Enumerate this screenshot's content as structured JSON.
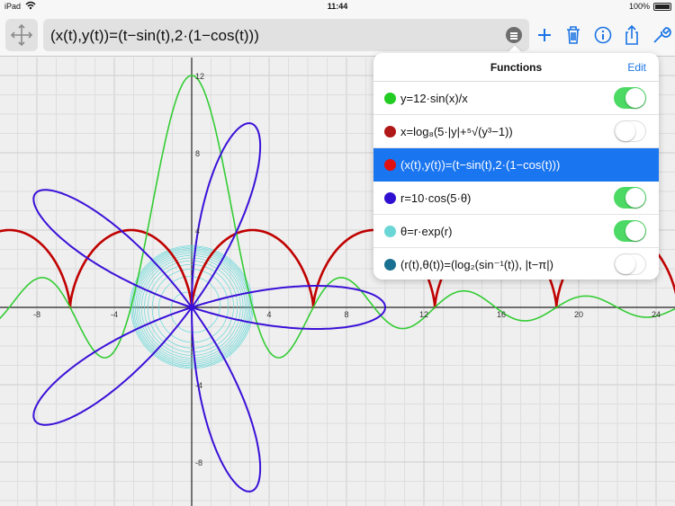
{
  "status": {
    "device": "iPad",
    "time": "11:44",
    "battery": "100%"
  },
  "toolbar": {
    "expression": "(x(t),y(t))=(t−sin(t),2·(1−cos(t)))"
  },
  "functions_panel": {
    "title": "Functions",
    "edit_label": "Edit",
    "items": [
      {
        "text": "y=12·sin(x)/x",
        "color": "#22cc22",
        "enabled": true
      },
      {
        "text": "x=log₈(5·|y|+⁵√(y³−1))",
        "color": "#b01818",
        "enabled": false
      },
      {
        "text": "(x(t),y(t))=(t−sin(t),2·(1−cos(t)))",
        "color": "#e01010",
        "enabled": true,
        "selected": true
      },
      {
        "text": "r=10·cos(5·θ)",
        "color": "#3010d0",
        "enabled": true
      },
      {
        "text": "θ=r·exp(r)",
        "color": "#6ad6d6",
        "enabled": true
      },
      {
        "text": "(r(t),θ(t))=(log₂(sin⁻¹(t)), |t−π|)",
        "color": "#1a7090",
        "enabled": false
      }
    ]
  },
  "graph": {
    "x_ticks": [
      "-8",
      "-4",
      "4",
      "8",
      "12",
      "16",
      "20",
      "24"
    ],
    "y_ticks": [
      "12",
      "8",
      "4",
      "-4",
      "-8"
    ],
    "colors": {
      "green": "#33cc33",
      "red": "#c00000",
      "blue": "#3a10d8",
      "cyan": "#68d8d8"
    }
  }
}
